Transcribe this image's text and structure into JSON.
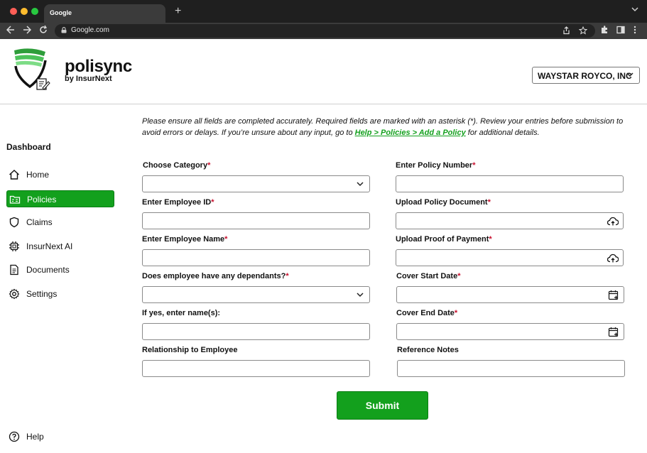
{
  "browser": {
    "tab_title": "Google",
    "new_tab": "+",
    "url": "Google.com"
  },
  "brand": {
    "name": "polisync",
    "tagline": "by InsurNext",
    "accent_color": "#13a01d"
  },
  "company_selector": {
    "value": "WAYSTAR ROYCO, INC"
  },
  "sidebar": {
    "title": "Dashboard",
    "items": [
      {
        "label": "Home",
        "icon": "home-icon"
      },
      {
        "label": "Policies",
        "icon": "folder-icon",
        "active": true
      },
      {
        "label": "Claims",
        "icon": "shield-icon"
      },
      {
        "label": "InsurNext AI",
        "icon": "chip-icon"
      },
      {
        "label": "Documents",
        "icon": "document-icon"
      },
      {
        "label": "Settings",
        "icon": "gear-icon"
      }
    ],
    "help": {
      "label": "Help",
      "icon": "help-icon"
    }
  },
  "intro": {
    "text": "Please ensure all fields are completed accurately. Required fields are marked with an asterisk (*). Review your entries before submission to avoid errors or delays. If you’re unsure about any input, go to ",
    "link": "Help > Policies > Add a Policy",
    "text_after": " for additional details."
  },
  "form": {
    "required_marker": "*",
    "left": [
      {
        "label": "Choose Category",
        "required": true,
        "type": "select",
        "value": ""
      },
      {
        "label": "Enter Employee ID",
        "required": true,
        "type": "text",
        "value": ""
      },
      {
        "label": "Enter Employee Name",
        "required": true,
        "type": "text",
        "value": ""
      },
      {
        "label": "Does employee have any dependants?",
        "required": true,
        "type": "select",
        "value": ""
      },
      {
        "label": "If yes, enter name(s):",
        "required": false,
        "type": "text",
        "value": ""
      },
      {
        "label": "Relationship to Employee",
        "required": false,
        "type": "text",
        "value": ""
      }
    ],
    "right": [
      {
        "label": "Enter Policy Number",
        "required": true,
        "type": "text",
        "value": ""
      },
      {
        "label": "Upload Policy Document",
        "required": true,
        "type": "upload",
        "value": ""
      },
      {
        "label": "Upload Proof of Payment",
        "required": true,
        "type": "upload",
        "value": ""
      },
      {
        "label": "Cover Start Date",
        "required": true,
        "type": "date",
        "value": ""
      },
      {
        "label": "Cover End Date",
        "required": true,
        "type": "date",
        "value": ""
      },
      {
        "label": "Reference Notes",
        "required": false,
        "type": "text",
        "value": ""
      }
    ],
    "submit_label": "Submit"
  }
}
